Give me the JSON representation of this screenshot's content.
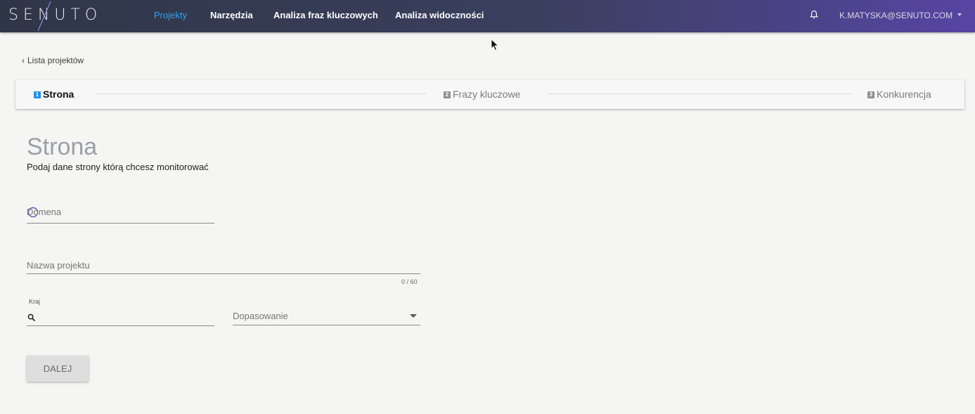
{
  "app": {
    "logo_text": "SENUTO"
  },
  "nav": {
    "items": [
      {
        "label": "Projekty",
        "active": true
      },
      {
        "label": "Narzędzia",
        "active": false
      },
      {
        "label": "Analiza fraz kluczowych",
        "active": false
      },
      {
        "label": "Analiza widoczności",
        "active": false
      }
    ],
    "bell_icon": "bell-icon",
    "user_email": "K.MATYSKA@SENUTO.COM"
  },
  "back_link": "Lista projektów",
  "steps": [
    {
      "number": "1",
      "label": "Strona",
      "active": true
    },
    {
      "number": "2",
      "label": "Frazy kluczowe",
      "active": false
    },
    {
      "number": "3",
      "label": "Konkurencja",
      "active": false
    }
  ],
  "form": {
    "title": "Strona",
    "subtitle": "Podaj dane strony którą chcesz monitorować",
    "domain_label": "Domena",
    "project_name_label": "Nazwa projektu",
    "project_name_counter": "0 / 60",
    "country_label": "Kraj",
    "match_label": "Dopasowanie",
    "next_button": "DALEJ"
  },
  "colors": {
    "accent": "#2ea3f2",
    "step_active": "#1f8fe8",
    "nav_gradient_start": "#2f3647",
    "nav_gradient_end": "#5745a3"
  }
}
